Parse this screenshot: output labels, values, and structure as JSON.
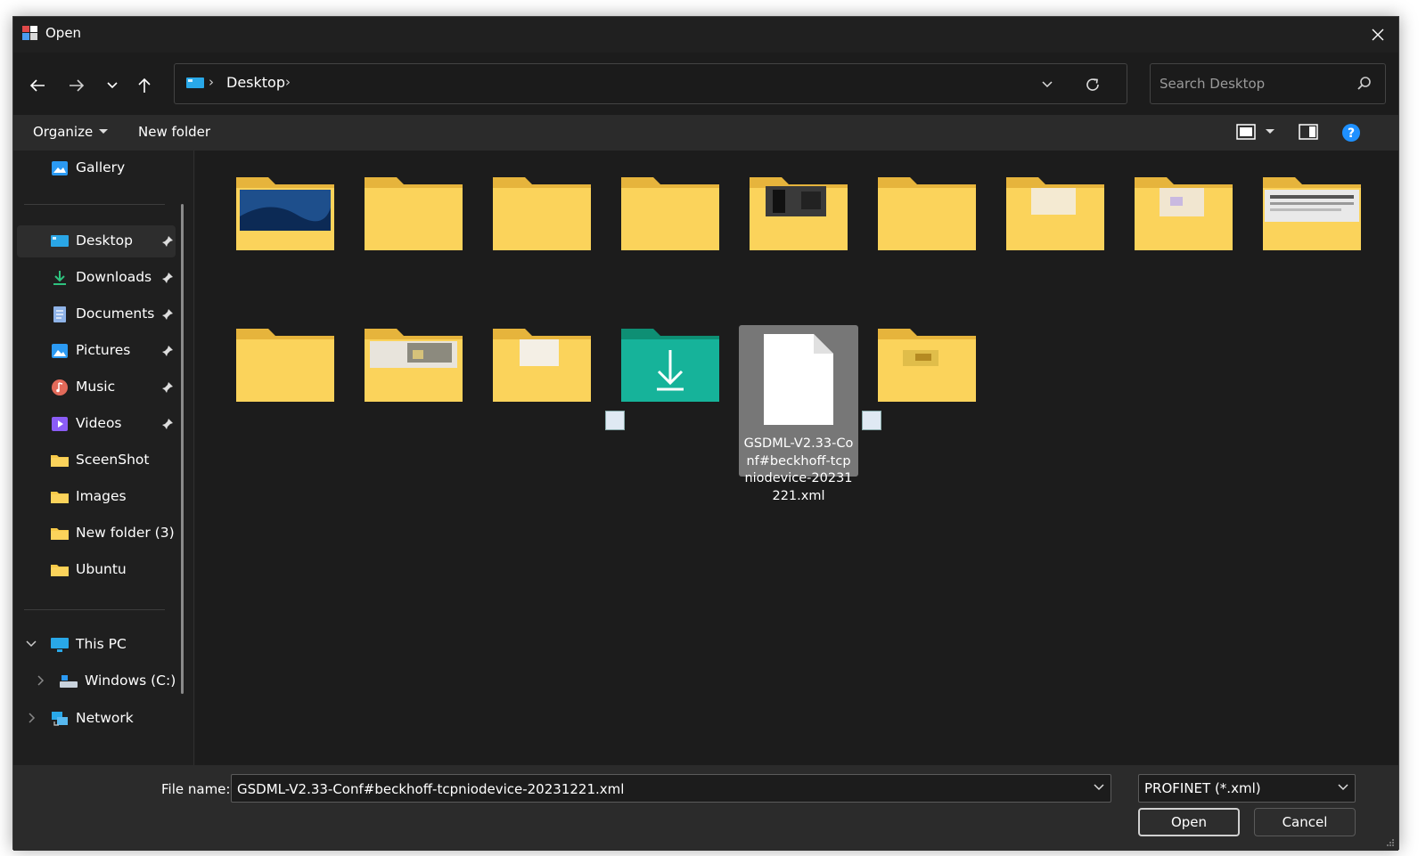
{
  "window": {
    "title": "Open"
  },
  "navigation": {
    "back_icon": "arrow-left-icon",
    "forward_icon": "arrow-right-icon",
    "recent_icon": "chevron-down-icon",
    "up_icon": "arrow-up-icon",
    "breadcrumb": [
      "Desktop"
    ],
    "search_placeholder": "Search Desktop"
  },
  "commandbar": {
    "organize_label": "Organize",
    "new_folder_label": "New folder"
  },
  "sidebar": {
    "quick": [
      {
        "label": "Gallery",
        "icon": "gallery-icon"
      }
    ],
    "pinned": [
      {
        "label": "Desktop",
        "icon": "desktop-icon",
        "pinned": true,
        "selected": true
      },
      {
        "label": "Downloads",
        "icon": "download-icon",
        "pinned": true
      },
      {
        "label": "Documents",
        "icon": "documents-icon",
        "pinned": true
      },
      {
        "label": "Pictures",
        "icon": "pictures-icon",
        "pinned": true
      },
      {
        "label": "Music",
        "icon": "music-icon",
        "pinned": true
      },
      {
        "label": "Videos",
        "icon": "videos-icon",
        "pinned": true
      },
      {
        "label": "SceenShot",
        "icon": "folder-icon"
      },
      {
        "label": "Images",
        "icon": "folder-icon"
      },
      {
        "label": "New folder (3)",
        "icon": "folder-icon"
      },
      {
        "label": "Ubuntu",
        "icon": "folder-icon"
      }
    ],
    "tree": [
      {
        "label": "This PC",
        "icon": "computer-icon",
        "expanded": true
      },
      {
        "label": "Windows (C:)",
        "icon": "drive-icon"
      },
      {
        "label": "Network",
        "icon": "network-icon"
      }
    ]
  },
  "files": {
    "selected_file_label": "GSDML-V2.33-Conf#beckhoff-tcpniodevice-20231221.xml"
  },
  "bottom": {
    "file_name_label": "File name:",
    "file_name_value": "GSDML-V2.33-Conf#beckhoff-tcpniodevice-20231221.xml",
    "file_type_value": "PROFINET (*.xml)",
    "open_label": "Open",
    "cancel_label": "Cancel"
  },
  "colors": {
    "accent": "#0a84ff",
    "folder": "#f7c948",
    "selection": "#777777"
  }
}
